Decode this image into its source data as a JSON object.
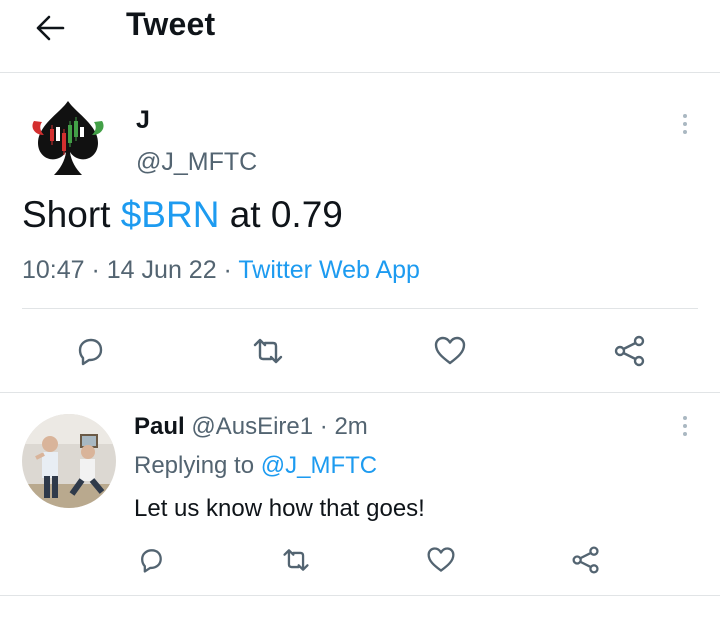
{
  "header": {
    "title": "Tweet"
  },
  "main_tweet": {
    "name": "J",
    "handle": "@J_MFTC",
    "text_before": "Short ",
    "cashtag": "$BRN",
    "text_after": " at 0.79",
    "time": "10:47",
    "separator": " · ",
    "date": "14 Jun 22",
    "source": "Twitter Web App",
    "actions": [
      "reply-icon",
      "retweet-icon",
      "like-icon",
      "share-icon"
    ]
  },
  "reply": {
    "name": "Paul",
    "handle": "@AusEire1",
    "separator": " · ",
    "age": "2m",
    "replying_prefix": "Replying to ",
    "replying_to": "@J_MFTC",
    "text": "Let us know how that goes!"
  },
  "colors": {
    "accent": "#1d9bf0",
    "secondary_text": "#536471",
    "primary_text": "#0f1419",
    "icon_gray": "#536471",
    "divider": "#e1e4e6"
  }
}
